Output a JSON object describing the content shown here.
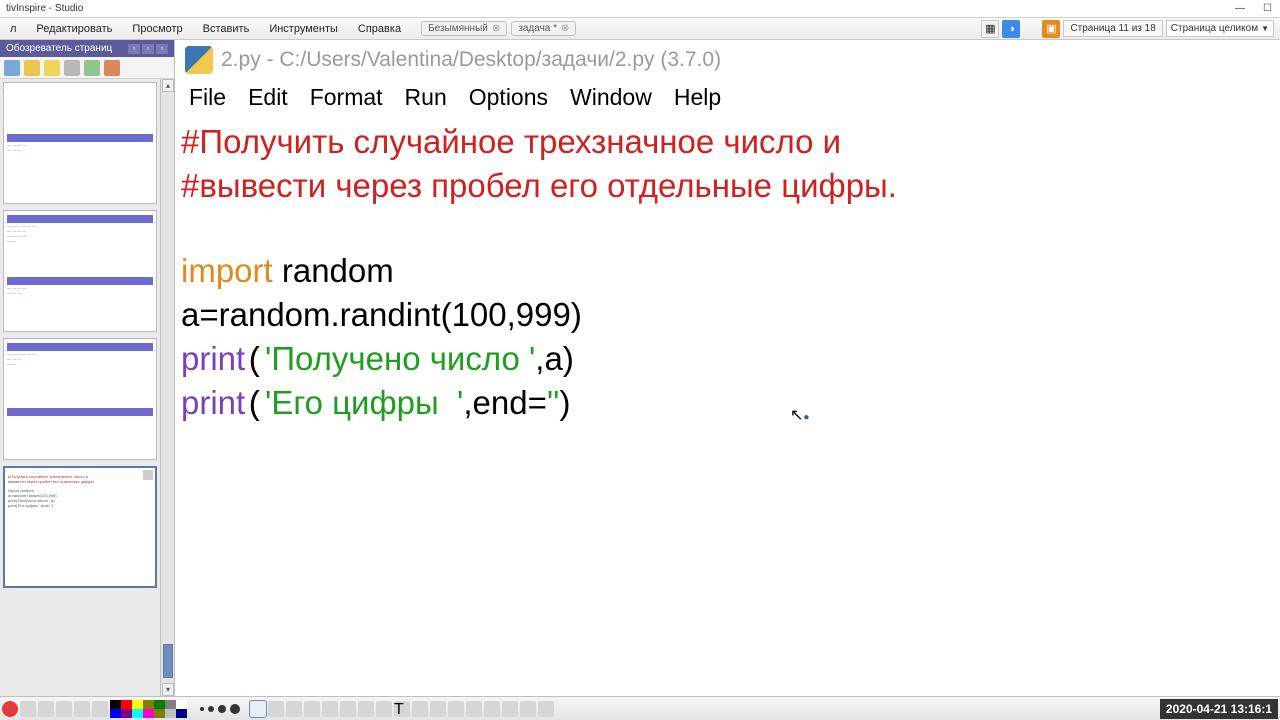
{
  "app_title": "tivInspire - Studio",
  "menu": [
    "л",
    "Редактировать",
    "Просмотр",
    "Вставить",
    "Инструменты",
    "Справка"
  ],
  "tabs": [
    {
      "label": "Безымянный",
      "modified": false
    },
    {
      "label": "задача *",
      "modified": true
    }
  ],
  "page_indicator": "Страница 11 из 18",
  "page_mode": "Страница целиком",
  "sidebar_title": "Обозреватель страниц",
  "idle": {
    "title": "2.py - C:/Users/Valentina/Desktop/задачи/2.py (3.7.0)",
    "menu": [
      "File",
      "Edit",
      "Format",
      "Run",
      "Options",
      "Window",
      "Help"
    ]
  },
  "code": {
    "comment1": "#Получить случайное трехзначное число и",
    "comment2": "#вывести через пробел его отдельные цифры.",
    "import_kw": "import",
    "import_mod": " random",
    "line3": "a=random.randint(100,999)",
    "print_kw": "print",
    "str1": "'Получено число '",
    "after1": ",a)",
    "str2": "'Его цифры  '",
    "after2a": ",end=",
    "str_empty": "''",
    "after2b": ")"
  },
  "timestamp": "2020-04-21 13:16:1"
}
